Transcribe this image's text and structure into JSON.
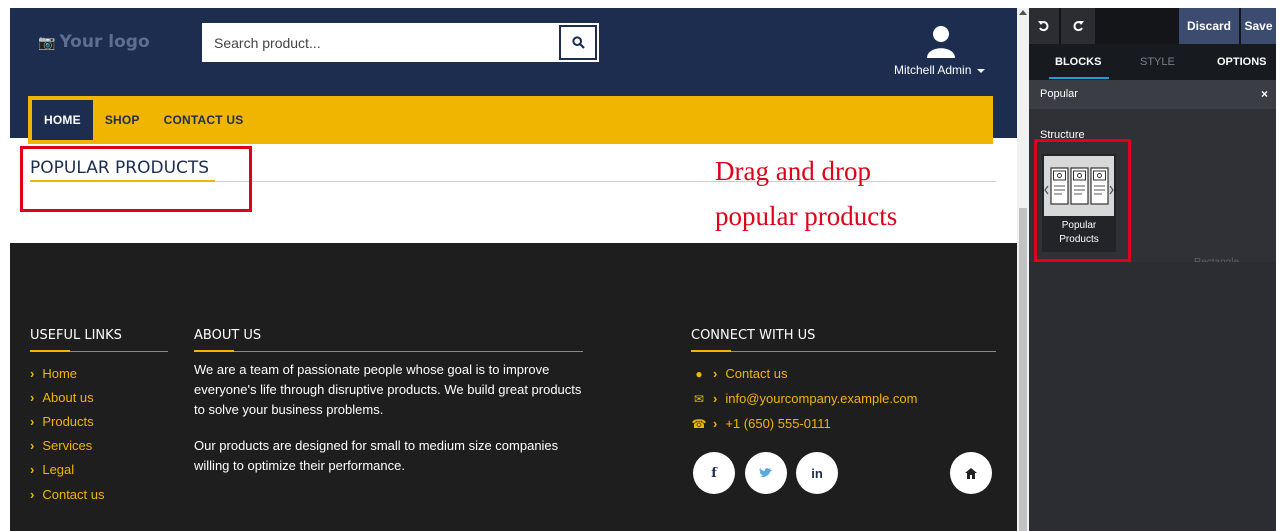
{
  "site": {
    "logo_text": "Your logo",
    "search_placeholder": "Search product...",
    "user_name": "Mitchell Admin",
    "nav": [
      "HOME",
      "SHOP",
      "CONTACT US"
    ],
    "popular_title": "POPULAR PRODUCTS",
    "annotation_line1": "Drag and drop",
    "annotation_line2": "popular products"
  },
  "footer": {
    "useful_links_heading": "USEFUL LINKS",
    "links": [
      "Home",
      "About us",
      "Products",
      "Services",
      "Legal",
      "Contact us"
    ],
    "about_heading": "ABOUT US",
    "about_p1": "We are a team of passionate people whose goal is to improve everyone's life through disruptive products. We build great products to solve your business problems.",
    "about_p2": "Our products are designed for small to medium size companies willing to optimize their performance.",
    "connect_heading": "CONNECT WITH US",
    "contact_us": "Contact us",
    "email": "info@yourcompany.example.com",
    "phone": "+1 (650) 555-0111",
    "social": [
      "f",
      "in"
    ]
  },
  "editor": {
    "discard_label": "Discard",
    "save_label": "Save",
    "tabs": [
      "BLOCKS",
      "STYLE",
      "OPTIONS"
    ],
    "search_value": "Popular",
    "structure_label": "Structure",
    "snippet_label_1": "Popular",
    "snippet_label_2": "Products",
    "rectangle_label": "Rectangle"
  },
  "colors": {
    "header_navy": "#1c2d4f",
    "accent_yellow": "#f0b500",
    "footer_dark": "#1e1e1e",
    "annotation_red": "#e0001a",
    "editor_dark": "#2b2d33",
    "editor_blue": "#3c4b70",
    "tab_underline": "#1a9fd4"
  }
}
